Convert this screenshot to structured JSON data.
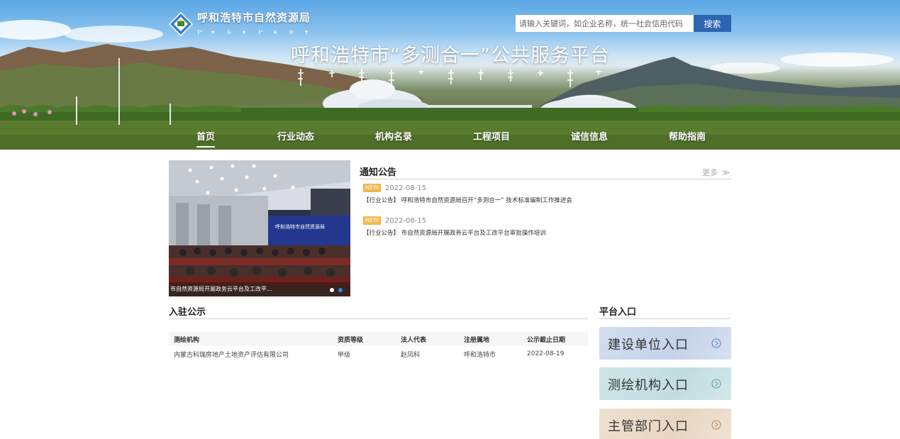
{
  "header": {
    "org_name": "呼和浩特市自然资源局",
    "platform_title": "呼和浩特市“多测合一”公共服务平台",
    "search": {
      "placeholder": "请输入关键词，如企业名称，统一社会信用代码",
      "button_label": "搜索"
    }
  },
  "nav": {
    "items": [
      {
        "label": "首页",
        "active": true
      },
      {
        "label": "行业动态"
      },
      {
        "label": "机构名录"
      },
      {
        "label": "工程项目"
      },
      {
        "label": "诚信信息"
      },
      {
        "label": "帮助指南"
      }
    ]
  },
  "carousel": {
    "caption": "市自然资源局开展政务云平台及工改平...",
    "slide_banner_text": "呼和浩特市自然资源局",
    "active_index": 1,
    "slide_count": 2
  },
  "notice": {
    "title": "通知公告",
    "more_label": "更多",
    "items": [
      {
        "badge": "NEW",
        "date": "2022-08-15",
        "text": "【行业公告】 呼和浩特市自然资源局召开“多测合一” 技术标准编制工作推进会"
      },
      {
        "badge": "NEW",
        "date": "2022-08-15",
        "text": "【行业公告】 市自然资源局开展政务云平台及工改平台审批操作培训"
      }
    ]
  },
  "settled": {
    "title": "入驻公示",
    "columns": [
      "测绘机构",
      "资质等级",
      "法人代表",
      "注册属地",
      "公示截止日期"
    ],
    "rows": [
      [
        "内蒙古科瑞房地产土地资产评估有限公司",
        "甲级",
        "赵凤科",
        "呼和浩特市",
        "2022-08-19"
      ]
    ]
  },
  "platform_entry": {
    "title": "平台入口",
    "items": [
      {
        "label": "建设单位入口"
      },
      {
        "label": "测绘机构入口"
      },
      {
        "label": "主管部门入口"
      }
    ]
  },
  "colors": {
    "accent": "#2d66b0",
    "badge": "#f5b649",
    "entry_1": "#c9d6ec",
    "entry_2": "#c7e0e4",
    "entry_3": "#ecdccb"
  }
}
